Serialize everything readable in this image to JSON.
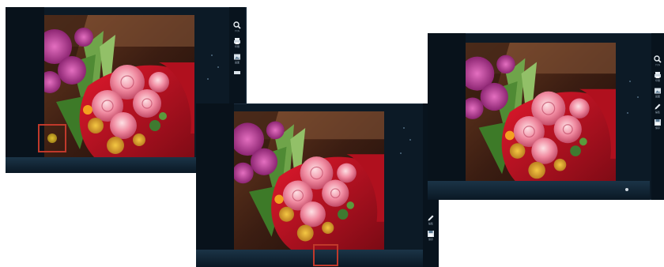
{
  "screens": [
    {
      "id": "left",
      "tools": [
        {
          "name": "search",
          "label": "ｱｲﾌﾙ"
        },
        {
          "name": "print",
          "label": "印刷"
        },
        {
          "name": "image",
          "label": "画面"
        },
        {
          "name": "more",
          "label": ""
        }
      ],
      "highlight": "favorite-icon"
    },
    {
      "id": "middle",
      "tools": [
        {
          "name": "edit",
          "label": "編集"
        },
        {
          "name": "save",
          "label": "保存"
        }
      ],
      "highlight": "bottom-area"
    },
    {
      "id": "right",
      "tools": [
        {
          "name": "search",
          "label": "ｱｲﾌﾙ"
        },
        {
          "name": "print",
          "label": "印刷"
        },
        {
          "name": "image",
          "label": "画面"
        },
        {
          "name": "edit",
          "label": "編集"
        },
        {
          "name": "save",
          "label": "保存"
        }
      ],
      "highlight": "none"
    }
  ],
  "colors": {
    "panel_bg": "#0c1a26",
    "toolbar_bg": "#08131d",
    "highlight": "#c0392b",
    "strip": "#1b3447"
  }
}
